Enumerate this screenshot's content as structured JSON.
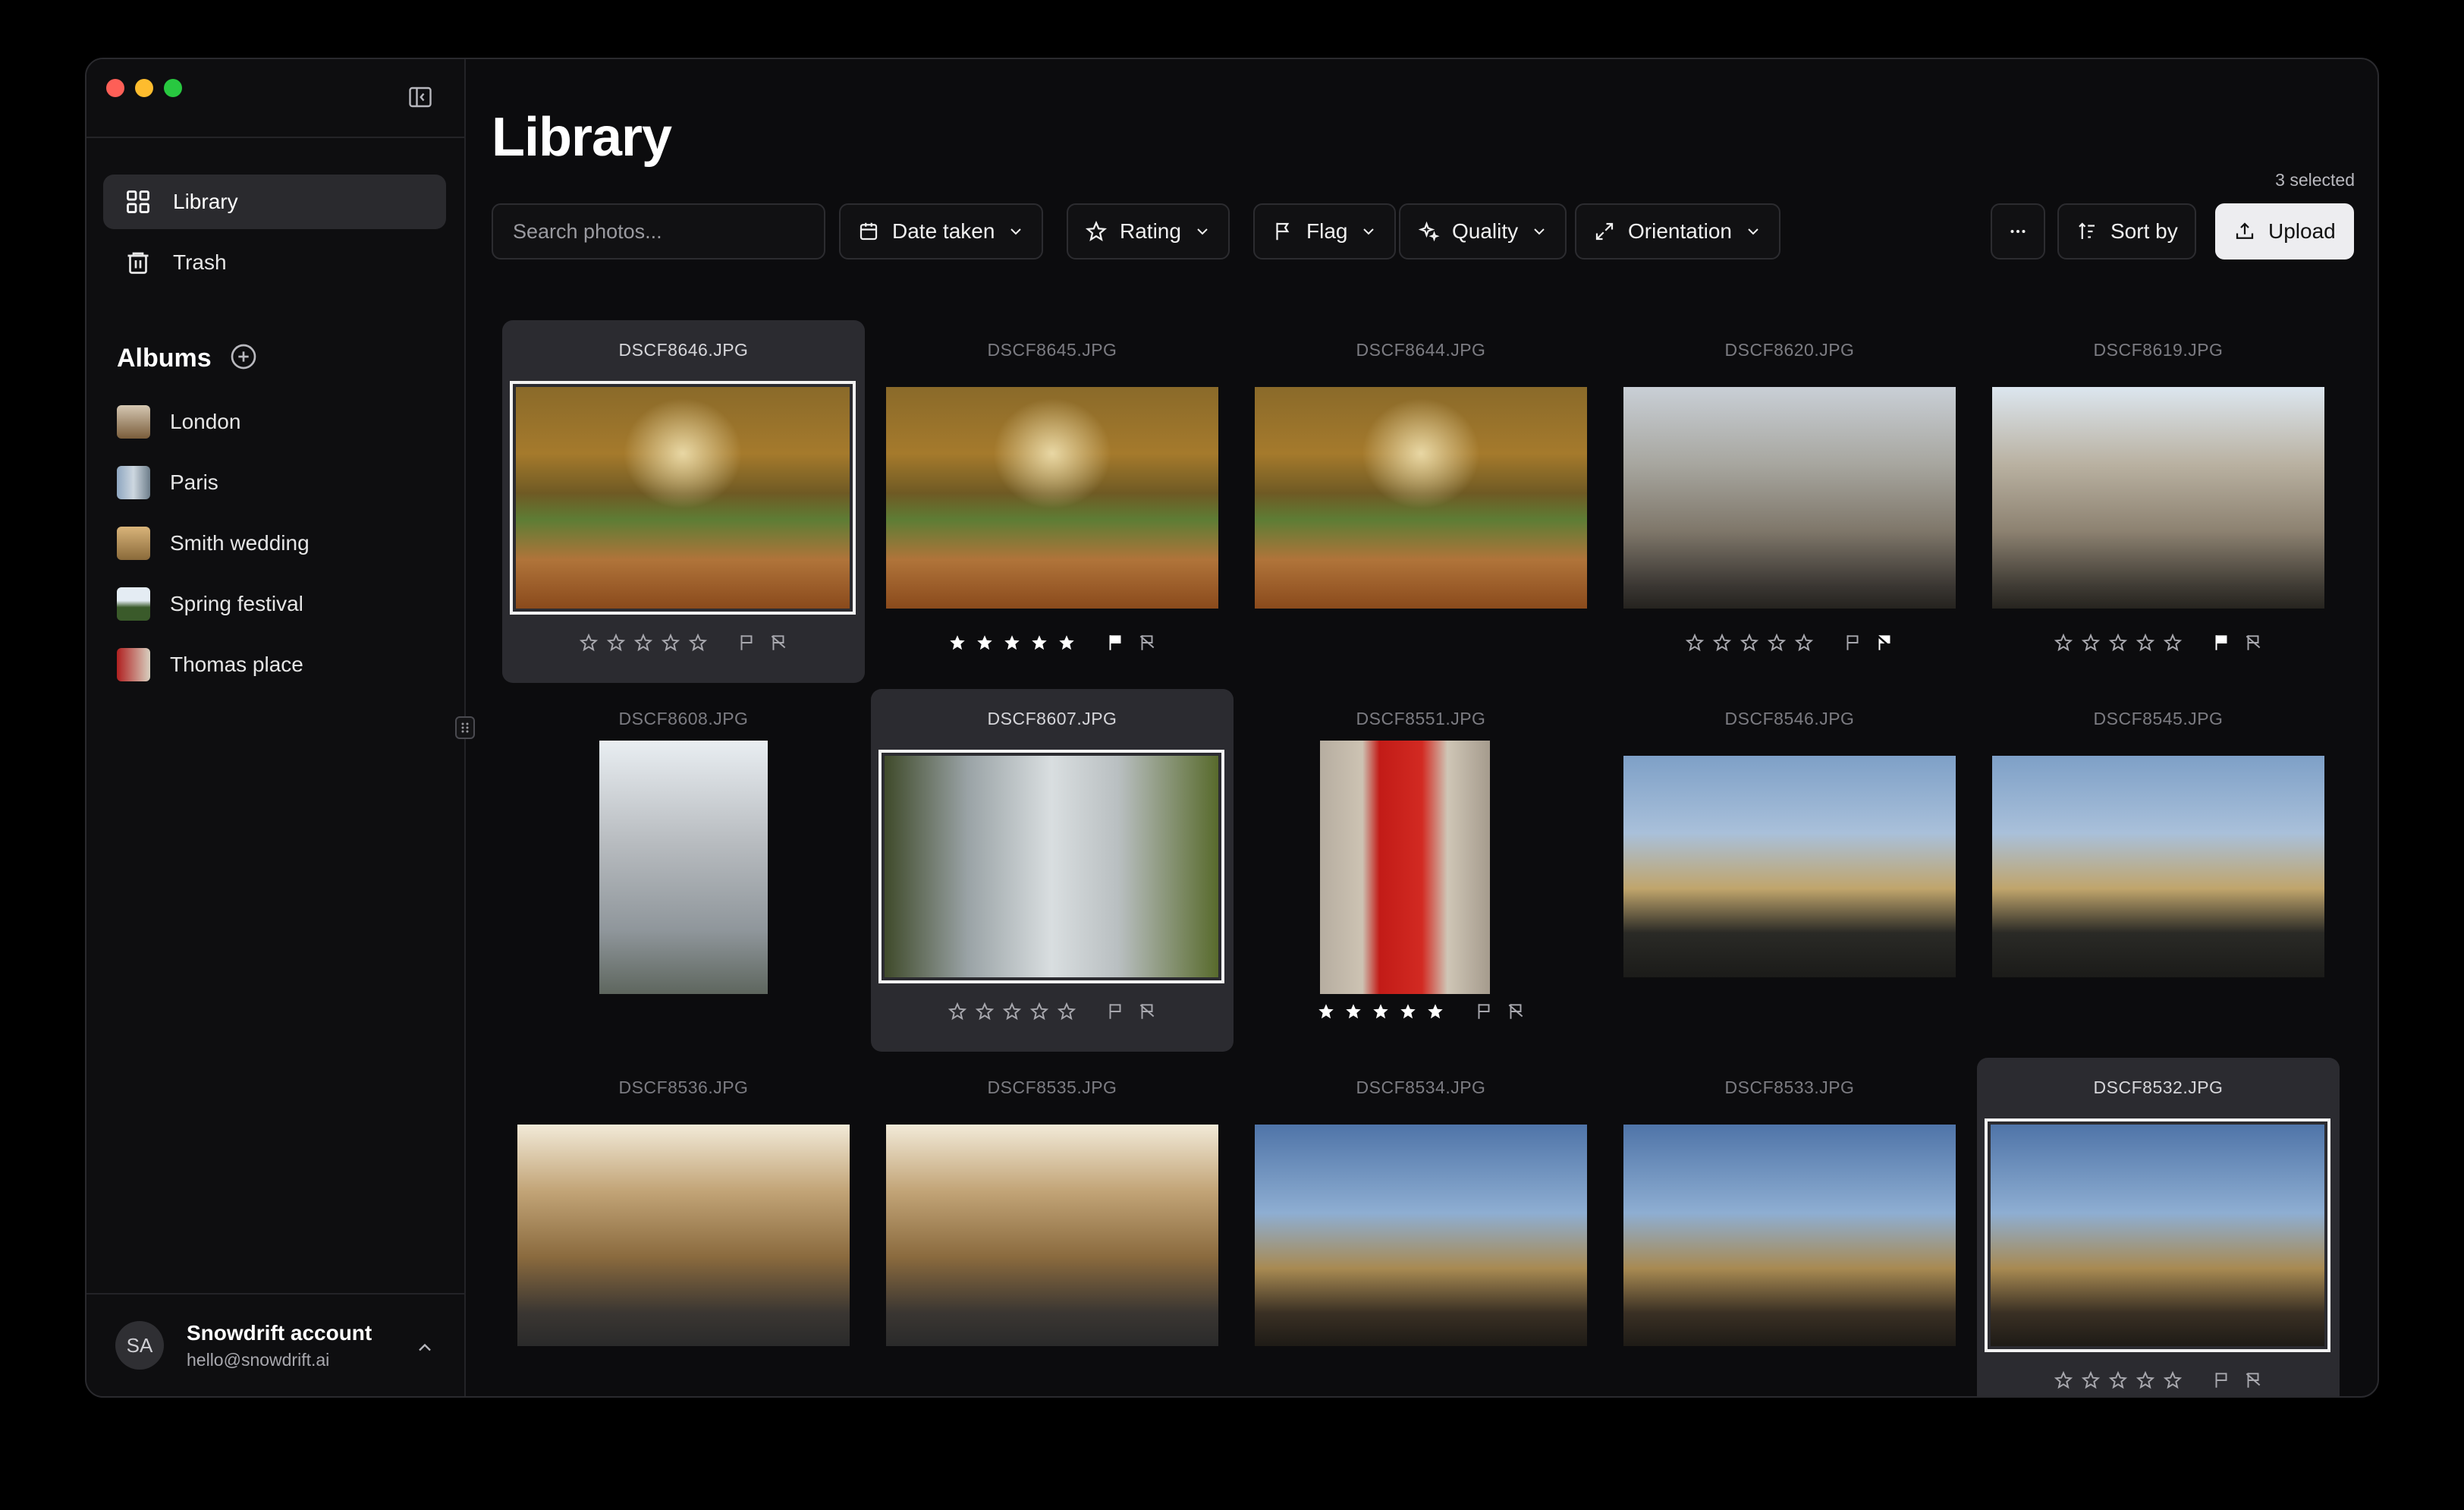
{
  "sidebar": {
    "nav": [
      {
        "label": "Library",
        "icon": "grid-icon",
        "active": true
      },
      {
        "label": "Trash",
        "icon": "trash-icon",
        "active": false
      }
    ],
    "albums_title": "Albums",
    "albums": [
      {
        "label": "London"
      },
      {
        "label": "Paris"
      },
      {
        "label": "Smith wedding"
      },
      {
        "label": "Spring festival"
      },
      {
        "label": "Thomas place"
      }
    ],
    "account": {
      "initials": "SA",
      "name": "Snowdrift account",
      "email": "hello@snowdrift.ai"
    }
  },
  "main": {
    "title": "Library",
    "selected_count": "3 selected",
    "search_placeholder": "Search photos...",
    "filters": {
      "date": "Date taken",
      "rating": "Rating",
      "flag": "Flag",
      "quality": "Quality",
      "orientation": "Orientation"
    },
    "sort_label": "Sort by",
    "upload_label": "Upload"
  },
  "photos": [
    {
      "name": "DSCF8646.JPG",
      "selected": true,
      "rating": 0,
      "flag": "none"
    },
    {
      "name": "DSCF8645.JPG",
      "selected": false,
      "rating": 5,
      "flag": "picked"
    },
    {
      "name": "DSCF8644.JPG",
      "selected": false,
      "rating": null,
      "flag": null
    },
    {
      "name": "DSCF8620.JPG",
      "selected": false,
      "rating": 0,
      "flag": "rejected"
    },
    {
      "name": "DSCF8619.JPG",
      "selected": false,
      "rating": 0,
      "flag": "picked"
    },
    {
      "name": "DSCF8608.JPG",
      "selected": false,
      "rating": null,
      "flag": null
    },
    {
      "name": "DSCF8607.JPG",
      "selected": true,
      "rating": 0,
      "flag": "none"
    },
    {
      "name": "DSCF8551.JPG",
      "selected": false,
      "rating": 5,
      "flag": "none"
    },
    {
      "name": "DSCF8546.JPG",
      "selected": false,
      "rating": null,
      "flag": null
    },
    {
      "name": "DSCF8545.JPG",
      "selected": false,
      "rating": null,
      "flag": null
    },
    {
      "name": "DSCF8536.JPG",
      "selected": false,
      "rating": null,
      "flag": null
    },
    {
      "name": "DSCF8535.JPG",
      "selected": false,
      "rating": null,
      "flag": null
    },
    {
      "name": "DSCF8534.JPG",
      "selected": false,
      "rating": null,
      "flag": null
    },
    {
      "name": "DSCF8533.JPG",
      "selected": false,
      "rating": null,
      "flag": null
    },
    {
      "name": "DSCF8532.JPG",
      "selected": true,
      "rating": 0,
      "flag": "none"
    }
  ]
}
